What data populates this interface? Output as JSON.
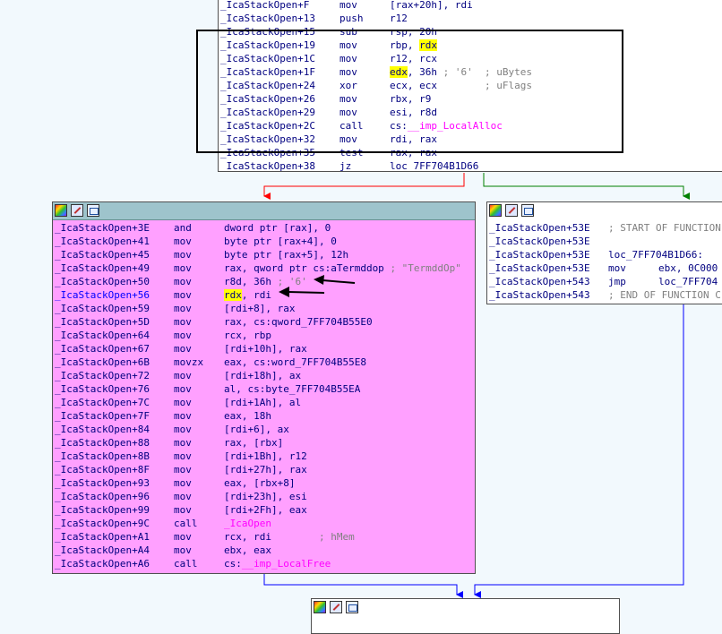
{
  "top_block": {
    "lines": [
      {
        "label": "_IcaStackOpen+F",
        "mnem": "mov",
        "ops": "[rax+20h], rdi"
      },
      {
        "label": "_IcaStackOpen+13",
        "mnem": "push",
        "ops": "r12"
      },
      {
        "label": "_IcaStackOpen+15",
        "mnem": "sub",
        "ops": "rsp, 20h"
      },
      {
        "label": "_IcaStackOpen+19",
        "mnem": "mov",
        "ops": "rbp, ",
        "hl": "rdx"
      },
      {
        "label": "_IcaStackOpen+1C",
        "mnem": "mov",
        "ops": "r12, rcx"
      },
      {
        "label": "_IcaStackOpen+1F",
        "mnem": "mov",
        "hl_pre": "edx",
        "ops": ", 36h ",
        "cmt": "; '6'  ; uBytes"
      },
      {
        "label": "_IcaStackOpen+24",
        "mnem": "xor",
        "ops": "ecx, ecx",
        "cmt": "        ; uFlags"
      },
      {
        "label": "_IcaStackOpen+26",
        "mnem": "mov",
        "ops": "rbx, r9"
      },
      {
        "label": "_IcaStackOpen+29",
        "mnem": "mov",
        "ops": "esi, r8d"
      },
      {
        "label": "_IcaStackOpen+2C",
        "mnem": "call",
        "ops": "cs:",
        "fn": "__imp_LocalAlloc"
      },
      {
        "label": "_IcaStackOpen+32",
        "mnem": "mov",
        "ops": "rdi, rax"
      },
      {
        "label": "_IcaStackOpen+35",
        "mnem": "test",
        "ops": "rax, rax"
      },
      {
        "label": "_IcaStackOpen+38",
        "mnem": "jz",
        "ops": "loc_7FF704B1D66"
      }
    ]
  },
  "left_block": {
    "lines": [
      {
        "label": "_IcaStackOpen+3E",
        "mnem": "and",
        "ops": "dword ptr [rax], 0"
      },
      {
        "label": "_IcaStackOpen+41",
        "mnem": "mov",
        "ops": "byte ptr [rax+4], 0"
      },
      {
        "label": "_IcaStackOpen+45",
        "mnem": "mov",
        "ops": "byte ptr [rax+5], 12h"
      },
      {
        "label": "_IcaStackOpen+49",
        "mnem": "mov",
        "ops": "rax, qword ptr cs:aTermddop ",
        "cmt": "; \"TermddOp\""
      },
      {
        "label": "_IcaStackOpen+50",
        "mnem": "mov",
        "ops": "r8d, 36h ",
        "cmt": "; '6'"
      },
      {
        "label": "_IcaStackOpen+56",
        "mnem": "mov",
        "hl_pre": "rdx",
        "ops": ", rdi",
        "current": true
      },
      {
        "label": "_IcaStackOpen+59",
        "mnem": "mov",
        "ops": "[rdi+8], rax"
      },
      {
        "label": "_IcaStackOpen+5D",
        "mnem": "mov",
        "ops": "rax, cs:qword_7FF704B55E0"
      },
      {
        "label": "_IcaStackOpen+64",
        "mnem": "mov",
        "ops": "rcx, rbp"
      },
      {
        "label": "_IcaStackOpen+67",
        "mnem": "mov",
        "ops": "[rdi+10h], rax"
      },
      {
        "label": "_IcaStackOpen+6B",
        "mnem": "movzx",
        "ops": "eax, cs:word_7FF704B55E8"
      },
      {
        "label": "_IcaStackOpen+72",
        "mnem": "mov",
        "ops": "[rdi+18h], ax"
      },
      {
        "label": "_IcaStackOpen+76",
        "mnem": "mov",
        "ops": "al, cs:byte_7FF704B55EA"
      },
      {
        "label": "_IcaStackOpen+7C",
        "mnem": "mov",
        "ops": "[rdi+1Ah], al"
      },
      {
        "label": "_IcaStackOpen+7F",
        "mnem": "mov",
        "ops": "eax, 18h"
      },
      {
        "label": "_IcaStackOpen+84",
        "mnem": "mov",
        "ops": "[rdi+6], ax"
      },
      {
        "label": "_IcaStackOpen+88",
        "mnem": "mov",
        "ops": "rax, [rbx]"
      },
      {
        "label": "_IcaStackOpen+8B",
        "mnem": "mov",
        "ops": "[rdi+1Bh], r12"
      },
      {
        "label": "_IcaStackOpen+8F",
        "mnem": "mov",
        "ops": "[rdi+27h], rax"
      },
      {
        "label": "_IcaStackOpen+93",
        "mnem": "mov",
        "ops": "eax, [rbx+8]"
      },
      {
        "label": "_IcaStackOpen+96",
        "mnem": "mov",
        "ops": "[rdi+23h], esi"
      },
      {
        "label": "_IcaStackOpen+99",
        "mnem": "mov",
        "ops": "[rdi+2Fh], eax"
      },
      {
        "label": "_IcaStackOpen+9C",
        "mnem": "call",
        "ops": "",
        "fn": "_IcaOpen"
      },
      {
        "label": "_IcaStackOpen+A1",
        "mnem": "mov",
        "ops": "rcx, rdi",
        "cmt": "        ; hMem"
      },
      {
        "label": "_IcaStackOpen+A4",
        "mnem": "mov",
        "ops": "ebx, eax"
      },
      {
        "label": "_IcaStackOpen+A6",
        "mnem": "call",
        "ops": "cs:",
        "fn": "__imp_LocalFree"
      }
    ]
  },
  "right_block": {
    "lines": [
      {
        "label": "_IcaStackOpen+53E",
        "mnem": "",
        "ops": "",
        "cmt": "; START OF FUNCTION"
      },
      {
        "label": "_IcaStackOpen+53E",
        "mnem": "",
        "ops": ""
      },
      {
        "label": "_IcaStackOpen+53E",
        "mnem": "",
        "ops": "loc_7FF704B1D66:"
      },
      {
        "label": "_IcaStackOpen+53E",
        "mnem": "mov",
        "ops": "ebx, 0C000"
      },
      {
        "label": "_IcaStackOpen+543",
        "mnem": "jmp",
        "ops": "loc_7FF704"
      },
      {
        "label": "_IcaStackOpen+543",
        "mnem": "",
        "ops": "",
        "cmt": "; END OF FUNCTION C"
      }
    ]
  },
  "colors": {
    "node_pink": "#ffa0ff",
    "header_teal": "#9ec4cc",
    "highlight": "#ffff00",
    "edge_false": "#ff0000",
    "edge_true": "#008000",
    "edge_normal": "#0000ff"
  }
}
